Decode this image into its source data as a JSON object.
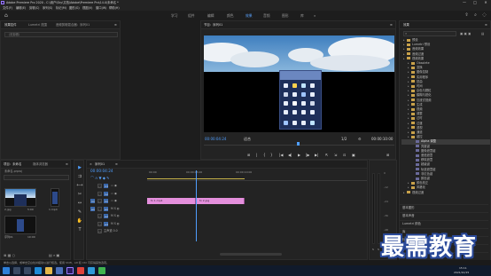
{
  "window": {
    "title": "Adobe Premiere Pro 2020 - C:\\用户\\Sky\\文档\\Adobe\\Premiere Pro\\14.0\\未命名 *",
    "minimize": "—",
    "maximize": "□",
    "close": "✕"
  },
  "menu": [
    "文件(F)",
    "编辑(E)",
    "剪辑(C)",
    "序列(S)",
    "标记(M)",
    "图形(G)",
    "视图(V)",
    "窗口(W)",
    "帮助(H)"
  ],
  "workspaces": [
    "学习",
    "组件",
    "编辑",
    "颜色",
    "效果",
    "音频",
    "图形",
    "库"
  ],
  "active_workspace": "效果",
  "source_panel": {
    "tabs": [
      "效果控件",
      "Lumetri 范围",
      "音频剪辑混合器：序列01"
    ],
    "combo_value": "（无剪辑）"
  },
  "program_monitor": {
    "tab": "节目：序列01",
    "timecode_current": "00:00:04:24",
    "fit_value": "适合",
    "quality": "1/2",
    "timecode_total": "00:00:10:00",
    "controls": [
      "⊞",
      "|",
      "{",
      "}",
      "|◀",
      "◀|",
      "▶",
      "|▶",
      "▶|",
      "⇱",
      "⇲",
      "⊡",
      "▣",
      "⊞"
    ]
  },
  "effects_panel": {
    "tab": "效果",
    "tree": [
      {
        "label": "预设",
        "type": "folder",
        "level": 0
      },
      {
        "label": "Lumetri 预设",
        "type": "folder",
        "level": 0
      },
      {
        "label": "音频效果",
        "type": "folder",
        "level": 0
      },
      {
        "label": "音频过渡",
        "type": "folder",
        "level": 0
      },
      {
        "label": "视频效果",
        "type": "folder",
        "level": 0
      },
      {
        "label": "Obsolete",
        "type": "folder",
        "level": 1
      },
      {
        "label": "变换",
        "type": "folder",
        "level": 1
      },
      {
        "label": "图像控制",
        "type": "folder",
        "level": 1
      },
      {
        "label": "实用程序",
        "type": "folder",
        "level": 1
      },
      {
        "label": "扭曲",
        "type": "folder",
        "level": 1
      },
      {
        "label": "时间",
        "type": "folder",
        "level": 1
      },
      {
        "label": "杂色与颗粒",
        "type": "folder",
        "level": 1
      },
      {
        "label": "模糊与锐化",
        "type": "folder",
        "level": 1
      },
      {
        "label": "沉浸式视频",
        "type": "folder",
        "level": 1
      },
      {
        "label": "生成",
        "type": "folder",
        "level": 1
      },
      {
        "label": "视频",
        "type": "folder",
        "level": 1
      },
      {
        "label": "调整",
        "type": "folder",
        "level": 1
      },
      {
        "label": "过时",
        "type": "folder",
        "level": 1
      },
      {
        "label": "过渡",
        "type": "folder",
        "level": 1
      },
      {
        "label": "透视",
        "type": "folder",
        "level": 1
      },
      {
        "label": "通道",
        "type": "folder",
        "level": 1
      },
      {
        "label": "键控",
        "type": "folder",
        "level": 1
      },
      {
        "label": "Alpha 调整",
        "type": "fx",
        "level": 2,
        "selected": true
      },
      {
        "label": "亮度键",
        "type": "fx",
        "level": 2
      },
      {
        "label": "图像遮罩键",
        "type": "fx",
        "level": 2
      },
      {
        "label": "差值遮罩",
        "type": "fx",
        "level": 2
      },
      {
        "label": "移除遮罩",
        "type": "fx",
        "level": 2
      },
      {
        "label": "超级键",
        "type": "fx",
        "level": 2
      },
      {
        "label": "轨道遮罩键",
        "type": "fx",
        "level": 2
      },
      {
        "label": "非红色键",
        "type": "fx",
        "level": 2
      },
      {
        "label": "颜色键",
        "type": "fx",
        "level": 2
      },
      {
        "label": "颜色校正",
        "type": "folder",
        "level": 1
      },
      {
        "label": "风格化",
        "type": "folder",
        "level": 1
      },
      {
        "label": "视频过渡",
        "type": "folder",
        "level": 0
      }
    ],
    "sections": [
      "基本图形",
      "基本声音",
      "Lumetri 颜色",
      "库",
      "标记",
      "历史记录",
      "信息"
    ]
  },
  "project_panel": {
    "tabs": [
      "项目：未命名",
      "媒体浏览器"
    ],
    "project_file": "未命名.prproj",
    "items": [
      {
        "name": "2.jpg",
        "duration": "5:00"
      },
      {
        "name": "1.mp4",
        "duration": "10:00"
      },
      {
        "name": "序列01",
        "duration": "10:00"
      }
    ]
  },
  "tools": [
    "▶",
    "⇉",
    "⟷",
    "◆",
    "✂",
    "↔",
    "✎",
    "✋",
    "T"
  ],
  "timeline": {
    "tab": "序列01",
    "timecode": "00:00:04:24",
    "ruler": [
      "00:00",
      "00:00:05:00",
      "00:00:10:00"
    ],
    "tracks": [
      {
        "name": "V3",
        "kind": "video"
      },
      {
        "name": "V2",
        "kind": "video"
      },
      {
        "name": "V1",
        "kind": "video",
        "source": "V1"
      },
      {
        "name": "A1",
        "kind": "audio",
        "source": "A1"
      },
      {
        "name": "A2",
        "kind": "audio"
      },
      {
        "name": "A3",
        "kind": "audio"
      },
      {
        "name": "主声道",
        "kind": "master",
        "value": "0.0"
      }
    ],
    "clips": [
      {
        "label": "fx 1.mp4",
        "track": "V1",
        "start": 0,
        "end": 5.0,
        "color": "#e48fdc"
      },
      {
        "label": "fx 2.jpg",
        "track": "V1",
        "start": 5.0,
        "end": 10.0,
        "color": "#e48fdc"
      }
    ],
    "playhead_time": 4.96,
    "duration": 10
  },
  "meters": {
    "labels": [
      "0",
      "-12",
      "-24",
      "-36",
      "-48",
      "dB"
    ],
    "solo": [
      "S",
      "S"
    ]
  },
  "status": {
    "text": "单击以选择，或单击空白处并拖动以进行框选。使用 Shift、Alt 和 Ctrl 可获得其他选项。"
  },
  "taskbar": {
    "time": "15:11",
    "date": "2021/10/15",
    "apps": [
      "start",
      "search",
      "taskview",
      "edge",
      "explorer",
      "store",
      "premiere",
      "chrome",
      "qq",
      "wechat"
    ]
  },
  "watermark": "最需教育"
}
